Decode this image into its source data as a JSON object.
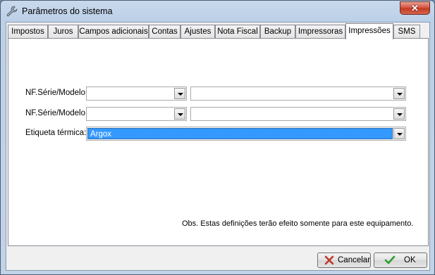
{
  "window": {
    "title": "Parâmetros do sistema",
    "close_glyph": "✕"
  },
  "tabs": [
    {
      "label": "Impostos",
      "active": false
    },
    {
      "label": "Juros",
      "active": false
    },
    {
      "label": "Campos adicionais",
      "active": false
    },
    {
      "label": "Contas",
      "active": false
    },
    {
      "label": "Ajustes",
      "active": false
    },
    {
      "label": "Nota Fiscal",
      "active": false
    },
    {
      "label": "Backup",
      "active": false
    },
    {
      "label": "Impressoras",
      "active": false
    },
    {
      "label": "Impressões",
      "active": true
    },
    {
      "label": "SMS",
      "active": false
    }
  ],
  "form": {
    "row1": {
      "label": "NF.Série/Modelo:",
      "combo1_value": "",
      "combo2_value": ""
    },
    "row2": {
      "label": "NF.Série/Modelo:",
      "combo1_value": "",
      "combo2_value": ""
    },
    "row3": {
      "label": "Etiqueta térmica:",
      "combo_value": "Argox"
    }
  },
  "note": "Obs. Estas definições terão efeito somente para este equipamento.",
  "buttons": {
    "cancel": {
      "label": "Cancelar",
      "icon": "cancel-x-icon",
      "icon_color": "#c0392b"
    },
    "ok": {
      "label": "OK",
      "icon": "checkmark-icon",
      "icon_color": "#2e9e2e"
    }
  }
}
